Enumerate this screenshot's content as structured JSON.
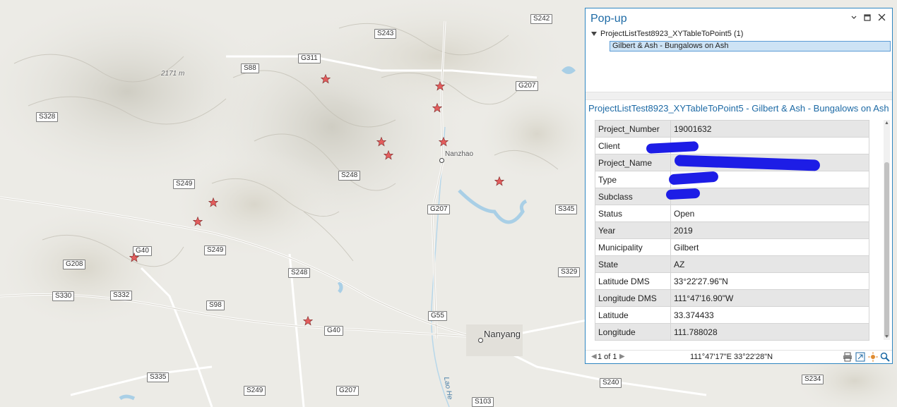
{
  "map": {
    "roads": [
      {
        "label": "S242",
        "name": "road-s242"
      },
      {
        "label": "S243",
        "name": "road-s243"
      },
      {
        "label": "G311",
        "name": "road-g311"
      },
      {
        "label": "S88",
        "name": "road-s88"
      },
      {
        "label": "G207",
        "name": "road-g207-north"
      },
      {
        "label": "S328",
        "name": "road-s328"
      },
      {
        "label": "S248",
        "name": "road-s248-north"
      },
      {
        "label": "S249",
        "name": "road-s249-west"
      },
      {
        "label": "G207",
        "name": "road-g207-mid"
      },
      {
        "label": "S345",
        "name": "road-s345"
      },
      {
        "label": "G40",
        "name": "road-g40-west"
      },
      {
        "label": "S249",
        "name": "road-s249-mid"
      },
      {
        "label": "G208",
        "name": "road-g208"
      },
      {
        "label": "S248",
        "name": "road-s248-south"
      },
      {
        "label": "S329",
        "name": "road-s329"
      },
      {
        "label": "S330",
        "name": "road-s330"
      },
      {
        "label": "S332",
        "name": "road-s332"
      },
      {
        "label": "S98",
        "name": "road-s98"
      },
      {
        "label": "G55",
        "name": "road-g55"
      },
      {
        "label": "G40",
        "name": "road-g40-east"
      },
      {
        "label": "S335",
        "name": "road-s335"
      },
      {
        "label": "S249",
        "name": "road-s249-south"
      },
      {
        "label": "G207",
        "name": "road-g207-south"
      },
      {
        "label": "S240",
        "name": "road-s240"
      },
      {
        "label": "S234",
        "name": "road-s234"
      },
      {
        "label": "S103",
        "name": "road-s103"
      }
    ],
    "places": {
      "elevation": "2171 m",
      "nanzhao": "Nanzhao",
      "nanyang": "Nanyang",
      "river": "Lao He"
    },
    "star_color": "#e35d5d"
  },
  "popup": {
    "title": "Pop-up",
    "layer_item": "ProjectListTest8923_XYTableToPoint5 (1)",
    "feature_item": "Gilbert & Ash - Bungalows on Ash",
    "feature_header": "ProjectListTest8923_XYTableToPoint5 - Gilbert & Ash - Bungalows on Ash",
    "fields": [
      {
        "key": "Project_Number",
        "value": "19001632"
      },
      {
        "key": "Client",
        "value": ""
      },
      {
        "key": "Project_Name",
        "value": ""
      },
      {
        "key": "Type",
        "value": ""
      },
      {
        "key": "Subclass",
        "value": ""
      },
      {
        "key": "Status",
        "value": "Open"
      },
      {
        "key": "Year",
        "value": "2019"
      },
      {
        "key": "Municipality",
        "value": "Gilbert"
      },
      {
        "key": "State",
        "value": "AZ"
      },
      {
        "key": "Latitude DMS",
        "value": " 33°22'27.96\"N"
      },
      {
        "key": "Longitude DMS",
        "value": "111°47'16.90\"W"
      },
      {
        "key": "Latitude",
        "value": "33.374433"
      },
      {
        "key": "Longitude",
        "value": "111.788028"
      }
    ],
    "pager": "1 of 1",
    "coordinates": "111°47'17\"E 33°22'28\"N",
    "accent_color": "#1d6aa5"
  }
}
